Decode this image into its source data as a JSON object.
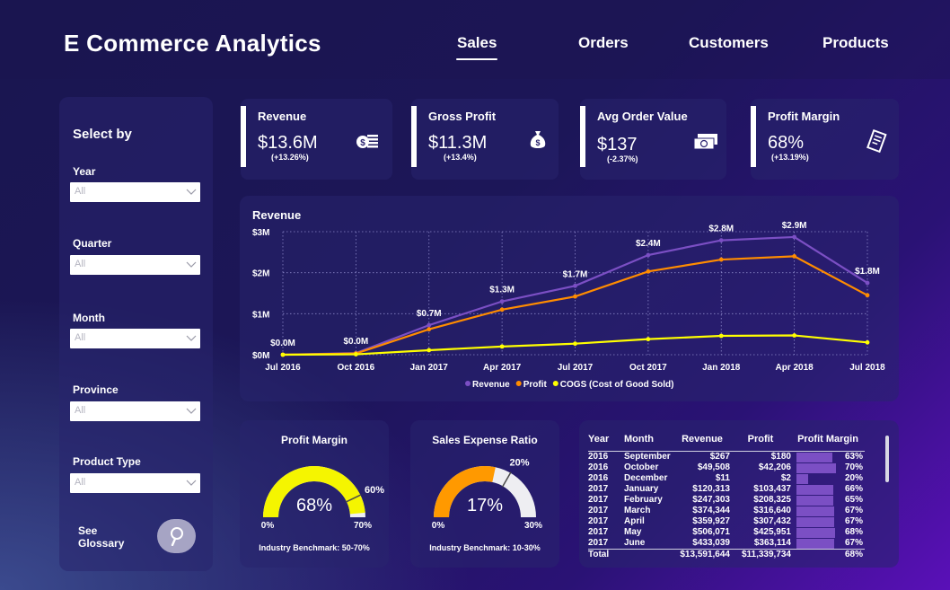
{
  "header": {
    "title": "E Commerce Analytics",
    "tabs": [
      "Sales",
      "Orders",
      "Customers",
      "Products"
    ],
    "active_tab": "Sales"
  },
  "slicers": {
    "heading": "Select by",
    "fields": [
      {
        "label": "Year",
        "value": "All"
      },
      {
        "label": "Quarter",
        "value": "All"
      },
      {
        "label": "Month",
        "value": "All"
      },
      {
        "label": "Province",
        "value": "All"
      },
      {
        "label": "Product Type",
        "value": "All"
      }
    ],
    "glossary_label": "See Glossary"
  },
  "kpis": [
    {
      "title": "Revenue",
      "value": "$13.6M",
      "delta": "(+13.26%)",
      "icon": "cash-icon"
    },
    {
      "title": "Gross Profit",
      "value": "$11.3M",
      "delta": "(+13.4%)",
      "icon": "money-bag-icon"
    },
    {
      "title": "Avg Order Value",
      "value": "$137",
      "delta": "(-2.37%)",
      "icon": "money-stack-icon"
    },
    {
      "title": "Profit Margin",
      "value": "68%",
      "delta": "(+13.19%)",
      "icon": "receipt-icon"
    }
  ],
  "chart_data": {
    "type": "line",
    "title": "Revenue",
    "x": [
      "Jul 2016",
      "Oct 2016",
      "Jan 2017",
      "Apr 2017",
      "Jul 2017",
      "Oct 2017",
      "Jan 2018",
      "Apr 2018",
      "Jul 2018"
    ],
    "series": [
      {
        "name": "Revenue",
        "color": "#7b4fc4",
        "values": [
          0.0,
          0.04,
          0.72,
          1.3,
          1.68,
          2.43,
          2.79,
          2.87,
          1.75
        ]
      },
      {
        "name": "Profit",
        "color": "#ff8c00",
        "values": [
          0.0,
          0.03,
          0.62,
          1.1,
          1.42,
          2.03,
          2.32,
          2.4,
          1.45
        ]
      },
      {
        "name": "COGS (Cost of Good Sold)",
        "color": "#ffff00",
        "values": [
          0.0,
          0.01,
          0.11,
          0.2,
          0.27,
          0.38,
          0.46,
          0.47,
          0.3
        ]
      }
    ],
    "data_labels": [
      "$0.0M",
      "$0.0M",
      "$0.7M",
      "$1.3M",
      "$1.7M",
      "$2.4M",
      "$2.8M",
      "$2.9M",
      "$1.8M"
    ],
    "yticks": [
      "$0M",
      "$1M",
      "$2M",
      "$3M"
    ],
    "ylim": [
      0,
      3
    ],
    "grid": true,
    "legend": "bottom"
  },
  "gauges": [
    {
      "title": "Profit Margin",
      "value": 68,
      "value_label": "68%",
      "min_label": "0%",
      "max_label": "70%",
      "target_label": "60%",
      "max": 70,
      "target": 60,
      "color": "#f5f500",
      "footer": "Industry Benchmark: 50-70%"
    },
    {
      "title": "Sales Expense Ratio",
      "value": 17,
      "value_label": "17%",
      "min_label": "0%",
      "max_label": "30%",
      "target_label": "20%",
      "max": 30,
      "target": 20,
      "color": "#ff9900",
      "footer": "Industry Benchmark: 10-30%"
    }
  ],
  "matrix": {
    "headers": [
      "Year",
      "Month",
      "Revenue",
      "Profit",
      "Profit Margin"
    ],
    "rows": [
      {
        "year": "2016",
        "month": "September",
        "revenue": "$267",
        "profit": "$180",
        "margin": "63%",
        "margin_value": 63
      },
      {
        "year": "2016",
        "month": "October",
        "revenue": "$49,508",
        "profit": "$42,206",
        "margin": "70%",
        "margin_value": 70
      },
      {
        "year": "2016",
        "month": "December",
        "revenue": "$11",
        "profit": "$2",
        "margin": "20%",
        "margin_value": 20
      },
      {
        "year": "2017",
        "month": "January",
        "revenue": "$120,313",
        "profit": "$103,437",
        "margin": "66%",
        "margin_value": 66
      },
      {
        "year": "2017",
        "month": "February",
        "revenue": "$247,303",
        "profit": "$208,325",
        "margin": "65%",
        "margin_value": 65
      },
      {
        "year": "2017",
        "month": "March",
        "revenue": "$374,344",
        "profit": "$316,640",
        "margin": "67%",
        "margin_value": 67
      },
      {
        "year": "2017",
        "month": "April",
        "revenue": "$359,927",
        "profit": "$307,432",
        "margin": "67%",
        "margin_value": 67
      },
      {
        "year": "2017",
        "month": "May",
        "revenue": "$506,071",
        "profit": "$425,951",
        "margin": "68%",
        "margin_value": 68
      },
      {
        "year": "2017",
        "month": "June",
        "revenue": "$433,039",
        "profit": "$363,114",
        "margin": "67%",
        "margin_value": 67
      }
    ],
    "total": {
      "label": "Total",
      "revenue": "$13,591,644",
      "profit": "$11,339,734",
      "margin": "68%"
    }
  }
}
